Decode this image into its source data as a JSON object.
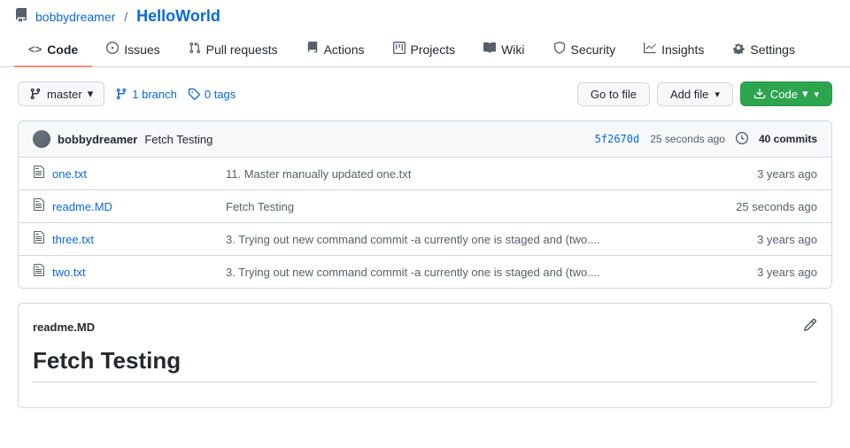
{
  "repo": {
    "owner": "bobbydreamer",
    "name": "HelloWorld",
    "icon": "⊞"
  },
  "nav": {
    "tabs": [
      {
        "id": "code",
        "label": "Code",
        "icon": "<>",
        "active": true
      },
      {
        "id": "issues",
        "label": "Issues",
        "icon": "ⓘ",
        "active": false
      },
      {
        "id": "pull-requests",
        "label": "Pull requests",
        "icon": "⇄",
        "active": false
      },
      {
        "id": "actions",
        "label": "Actions",
        "icon": "▶",
        "active": false
      },
      {
        "id": "projects",
        "label": "Projects",
        "icon": "▦",
        "active": false
      },
      {
        "id": "wiki",
        "label": "Wiki",
        "icon": "📖",
        "active": false
      },
      {
        "id": "security",
        "label": "Security",
        "icon": "🛡",
        "active": false
      },
      {
        "id": "insights",
        "label": "Insights",
        "icon": "📈",
        "active": false
      },
      {
        "id": "settings",
        "label": "Settings",
        "icon": "⚙",
        "active": false
      }
    ]
  },
  "toolbar": {
    "branch_label": "master",
    "branch_count": "1 branch",
    "tag_count": "0 tags",
    "go_to_file": "Go to file",
    "add_file": "Add file",
    "code_label": "Code"
  },
  "commit_bar": {
    "author": "bobbydreamer",
    "message": "Fetch Testing",
    "sha": "5f2670d",
    "time": "25 seconds ago",
    "commits_count": "40 commits"
  },
  "files": [
    {
      "name": "one.txt",
      "commit_message": "11. Master manually updated one.txt",
      "age": "3 years ago"
    },
    {
      "name": "readme.MD",
      "commit_message": "Fetch Testing",
      "age": "25 seconds ago"
    },
    {
      "name": "three.txt",
      "commit_message": "3. Trying out new command commit -a currently one is staged and (two....",
      "age": "3 years ago"
    },
    {
      "name": "two.txt",
      "commit_message": "3. Trying out new command commit -a currently one is staged and (two....",
      "age": "3 years ago"
    }
  ],
  "readme": {
    "filename": "readme.MD",
    "heading": "Fetch Testing"
  }
}
